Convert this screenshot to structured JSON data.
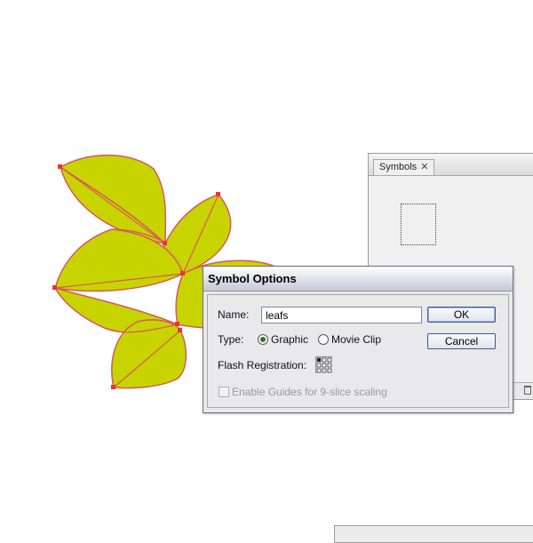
{
  "symbols_panel": {
    "tab_label": "Symbols",
    "close_glyph": "✕"
  },
  "dialog": {
    "title": "Symbol Options",
    "name_label": "Name:",
    "name_value": "leafs",
    "type_label": "Type:",
    "type_options": [
      "Graphic",
      "Movie Clip"
    ],
    "type_selected": "Graphic",
    "registration_label": "Flash Registration:",
    "guides_label": "Enable Guides for 9-slice scaling",
    "guides_checked": false,
    "guides_enabled": false,
    "ok_label": "OK",
    "cancel_label": "Cancel"
  },
  "colors": {
    "leaf_fill": "#c8d400",
    "leaf_stroke": "#d9534f",
    "anchor_point": "#ee3333",
    "dialog_bg": "#e9e9ec",
    "panel_bg": "#f0f0f0"
  }
}
